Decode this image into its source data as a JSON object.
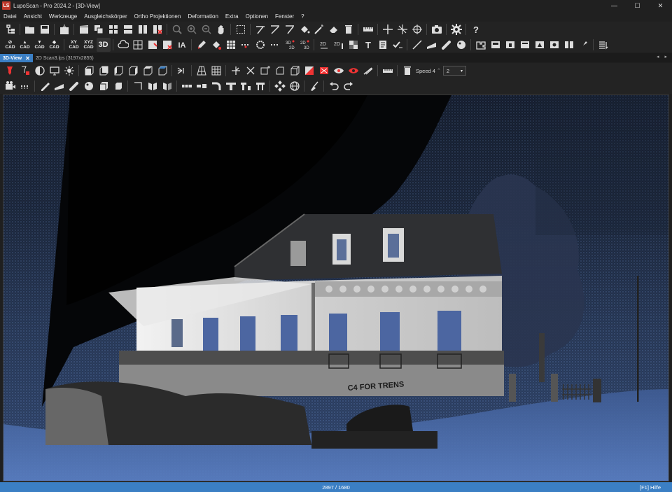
{
  "window": {
    "title": "LupoScan - Pro 2024.2 - [3D-View]",
    "app_icon_text": "LS"
  },
  "window_controls": {
    "minimize": "—",
    "maximize": "☐",
    "close": "✕"
  },
  "menu": [
    "Datei",
    "Ansicht",
    "Werkzeuge",
    "Ausgleichskörper",
    "Ortho Projektionen",
    "Deformation",
    "Extra",
    "Optionen",
    "Fenster",
    "?"
  ],
  "cad_buttons": [
    {
      "top": "⊘",
      "bottom": "CAD"
    },
    {
      "top": "▲",
      "bottom": "CAD"
    },
    {
      "top": "▼",
      "bottom": "CAD"
    },
    {
      "top": "◆",
      "bottom": "CAD"
    },
    {
      "top": "XY",
      "bottom": "CAD"
    },
    {
      "top": "XYZ",
      "bottom": "CAD"
    },
    {
      "top": "3D",
      "bottom": ""
    }
  ],
  "tabs": [
    {
      "label": "3D-View",
      "close": "✕"
    },
    {
      "label": "2D Scan3.lps (3197x2855)"
    }
  ],
  "tab_nav": "◂ ▸",
  "view_toolbar": {
    "speed_label": "Speed 4",
    "speed_value": "2"
  },
  "graffiti_text": "C4 FOR TRENS",
  "status": {
    "center": "2897 / 1680",
    "right": "[F1] Hilfe"
  },
  "colors": {
    "accent": "#3b7fc4",
    "toolbar_bg": "#232323",
    "viewport_sky_bottom": "#4a6aa5"
  }
}
